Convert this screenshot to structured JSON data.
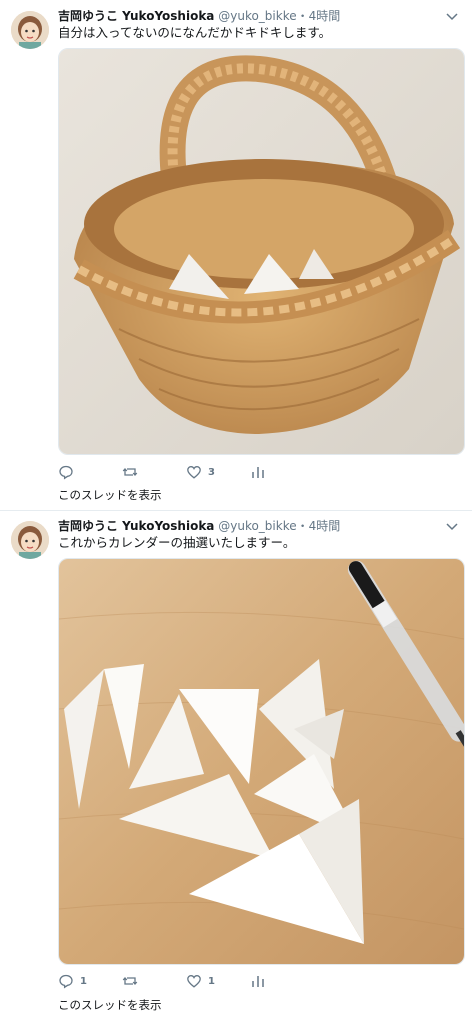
{
  "tweets": [
    {
      "display_name": "吉岡ゆうこ YukoYoshioka",
      "handle": "@yuko_bikke",
      "separator": "・",
      "time": "4時間",
      "text": "自分は入ってないのになんだかドキドキします。",
      "replies": "",
      "retweets": "",
      "likes": "3",
      "thread_link": "このスレッドを表示"
    },
    {
      "display_name": "吉岡ゆうこ YukoYoshioka",
      "handle": "@yuko_bikke",
      "separator": "・",
      "time": "4時間",
      "text": "これからカレンダーの抽選いたしますー。",
      "replies": "1",
      "retweets": "",
      "likes": "1",
      "thread_link": "このスレッドを表示"
    }
  ],
  "icons": {
    "reply": "reply-icon",
    "retweet": "retweet-icon",
    "like": "heart-icon",
    "analytics": "analytics-icon",
    "caret": "chevron-down-icon"
  },
  "colors": {
    "text_primary": "#14171a",
    "text_secondary": "#657786",
    "divider": "#e6ecf0"
  }
}
